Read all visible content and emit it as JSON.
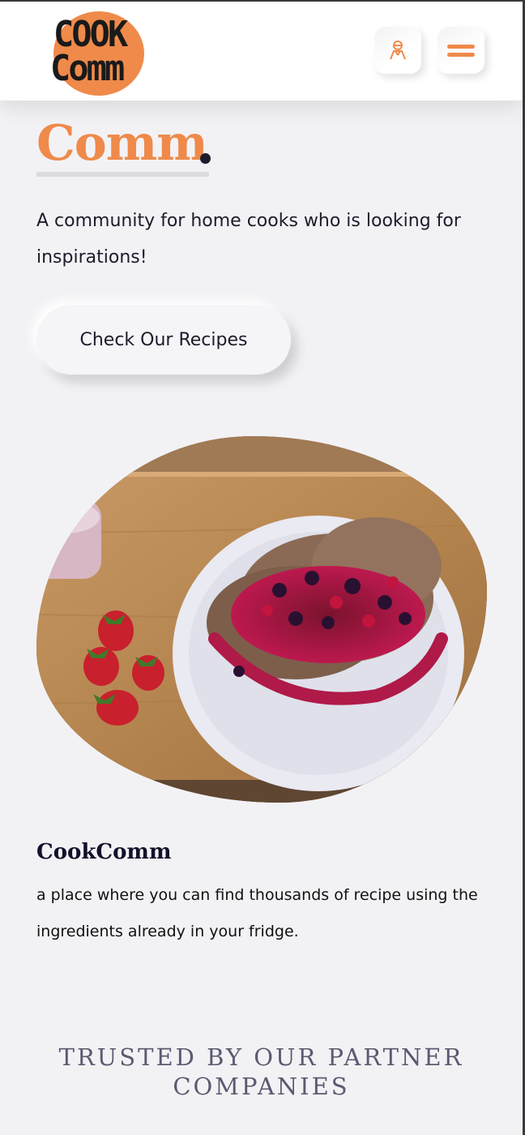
{
  "header": {
    "logo_line1": "COOK",
    "logo_line2": "Comm",
    "user_icon": "user-icon",
    "menu_icon": "hamburger-menu-icon"
  },
  "hero": {
    "title": "Comm",
    "title_dot": ".",
    "intro": "A community for home cooks who is looking for inspirations!",
    "cta_label": "Check Our Recipes"
  },
  "feature": {
    "image_alt": "pancakes with berries on a plate",
    "title": "CookComm",
    "text": "a place where you can find thousands of recipe using the ingredients already in your fridge."
  },
  "partners": {
    "heading": "TRUSTED BY OUR PARTNER COMPANIES"
  },
  "colors": {
    "accent": "#ef8a4a",
    "text": "#1c1c2b",
    "background": "#f2f2f5"
  }
}
